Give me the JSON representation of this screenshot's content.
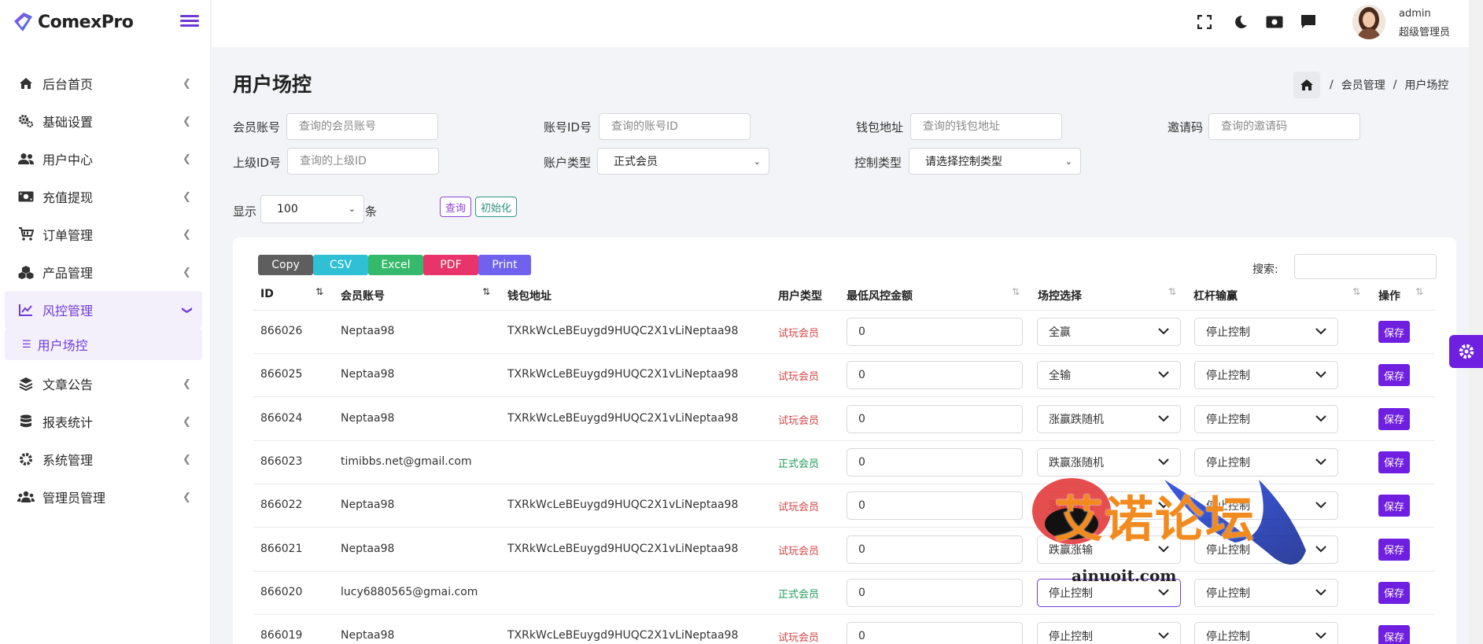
{
  "brand": {
    "name": "ComexPro"
  },
  "colors": {
    "accent": "#6f3bd8",
    "save": "#6f1fe0",
    "trial": "#d24545",
    "formal": "#1f9c5a"
  },
  "sidebar": {
    "items": [
      {
        "label": "后台首页",
        "icon": "home-icon"
      },
      {
        "label": "基础设置",
        "icon": "gears-icon"
      },
      {
        "label": "用户中心",
        "icon": "users-icon"
      },
      {
        "label": "充值提现",
        "icon": "money-icon"
      },
      {
        "label": "订单管理",
        "icon": "cart-icon"
      },
      {
        "label": "产品管理",
        "icon": "cubes-icon"
      },
      {
        "label": "风控管理",
        "icon": "chart-line-icon"
      },
      {
        "label": "文章公告",
        "icon": "layers-icon"
      },
      {
        "label": "报表统计",
        "icon": "database-icon"
      },
      {
        "label": "系统管理",
        "icon": "gear-icon"
      },
      {
        "label": "管理员管理",
        "icon": "user-group-icon"
      }
    ],
    "sub_item": "用户场控"
  },
  "user": {
    "name": "admin",
    "role": "超级管理员"
  },
  "page": {
    "title": "用户场控"
  },
  "breadcrumb": {
    "item1": "会员管理",
    "item2": "用户场控",
    "sep": "/"
  },
  "filters": {
    "member_label": "会员账号",
    "member_placeholder": "查询的会员账号",
    "account_label": "账号ID号",
    "account_placeholder": "查询的账号ID",
    "wallet_label": "钱包地址",
    "wallet_placeholder": "查询的钱包地址",
    "invite_label": "邀请码",
    "invite_placeholder": "查询的邀请码",
    "parent_label": "上级ID号",
    "parent_placeholder": "查询的上级ID",
    "acct_type_label": "账户类型",
    "acct_type_value": "正式会员",
    "ctrl_type_label": "控制类型",
    "ctrl_type_value": "请选择控制类型",
    "show_label": "显示",
    "show_value": "100",
    "show_unit": "条",
    "query_btn": "查询",
    "reset_btn": "初始化"
  },
  "export": {
    "copy": "Copy",
    "csv": "CSV",
    "excel": "Excel",
    "pdf": "PDF",
    "print": "Print"
  },
  "search": {
    "label": "搜索:"
  },
  "table": {
    "headers": {
      "id": "ID",
      "member": "会员账号",
      "wallet": "钱包地址",
      "type": "用户类型",
      "min_amount": "最低风控金额",
      "control": "场控选择",
      "leverage": "杠杆输赢",
      "action": "操作"
    },
    "save_label": "保存",
    "rows": [
      {
        "id": "866026",
        "member": "Neptaa98",
        "wallet": "TXRkWcLeBEuygd9HUQC2X1vLiNeptaa98",
        "type": "试玩会员",
        "min": "0",
        "control": "全赢",
        "leverage": "停止控制"
      },
      {
        "id": "866025",
        "member": "Neptaa98",
        "wallet": "TXRkWcLeBEuygd9HUQC2X1vLiNeptaa98",
        "type": "试玩会员",
        "min": "0",
        "control": "全输",
        "leverage": "停止控制"
      },
      {
        "id": "866024",
        "member": "Neptaa98",
        "wallet": "TXRkWcLeBEuygd9HUQC2X1vLiNeptaa98",
        "type": "试玩会员",
        "min": "0",
        "control": "涨赢跌随机",
        "leverage": "停止控制"
      },
      {
        "id": "866023",
        "member": "timibbs.net@gmail.com",
        "wallet": "",
        "type": "正式会员",
        "min": "0",
        "control": "跌赢涨随机",
        "leverage": "停止控制"
      },
      {
        "id": "866022",
        "member": "Neptaa98",
        "wallet": "TXRkWcLeBEuygd9HUQC2X1vLiNeptaa98",
        "type": "试玩会员",
        "min": "0",
        "control": "涨赢跌输",
        "leverage": "停止控制"
      },
      {
        "id": "866021",
        "member": "Neptaa98",
        "wallet": "TXRkWcLeBEuygd9HUQC2X1vLiNeptaa98",
        "type": "试玩会员",
        "min": "0",
        "control": "跌赢涨输",
        "leverage": "停止控制"
      },
      {
        "id": "866020",
        "member": "lucy6880565@gmai.com",
        "wallet": "",
        "type": "正式会员",
        "min": "0",
        "control": "停止控制",
        "leverage": "停止控制"
      },
      {
        "id": "866019",
        "member": "Neptaa98",
        "wallet": "TXRkWcLeBEuygd9HUQC2X1vLiNeptaa98",
        "type": "试玩会员",
        "min": "0",
        "control": "停止控制",
        "leverage": "停止控制"
      }
    ]
  },
  "watermark": {
    "text": "艾诺论坛",
    "url": "ainuoit.com"
  }
}
